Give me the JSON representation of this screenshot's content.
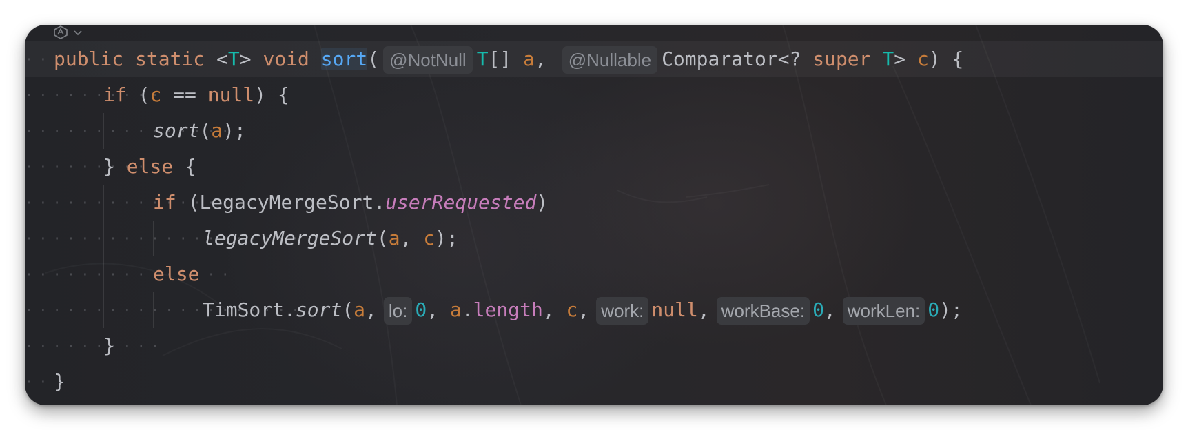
{
  "toolbar": {
    "icon": "ai-assistant-icon",
    "dropdown_icon": "chevron-down-icon"
  },
  "code": {
    "line1": {
      "kw_public": "public",
      "kw_static": "static",
      "lt": "<",
      "type_T": "T",
      "gt": ">",
      "kw_void": "void",
      "method_name": "sort",
      "open_paren": "(",
      "ann_notnull": "@NotNull",
      "param_type": "T",
      "brackets": "[]",
      "param_a": "a",
      "comma": ",",
      "ann_nullable": "@Nullable",
      "comparator": "Comparator<?",
      "kw_super": "super",
      "type_T2": "T",
      "gt2": ">",
      "param_c": "c",
      "close": ") {"
    },
    "line2": {
      "kw_if": "if",
      "open": "(",
      "var_c": "c",
      "op": "==",
      "kw_null": "null",
      "close": ") {"
    },
    "line3": {
      "call": "sort",
      "open": "(",
      "arg_a": "a",
      "close": ");"
    },
    "line4": {
      "brace": "}",
      "kw_else": "else",
      "open_brace": "{"
    },
    "line5": {
      "kw_if": "if",
      "open": "(",
      "cls": "LegacyMergeSort",
      "dot": ".",
      "field": "userRequested",
      "close": ")"
    },
    "line6": {
      "call": "legacyMergeSort",
      "open": "(",
      "arg_a": "a",
      "comma": ",",
      "arg_c": "c",
      "close": ");"
    },
    "line7": {
      "kw_else": "else"
    },
    "line8": {
      "cls": "TimSort",
      "dot": ".",
      "call": "sort",
      "open": "(",
      "arg_a": "a",
      "comma": ",",
      "hint_lo": "lo:",
      "num_0": "0",
      "arg_a2": "a",
      "dot2": ".",
      "field_length": "length",
      "arg_c": "c",
      "hint_work": "work:",
      "kw_null": "null",
      "hint_workbase": "workBase:",
      "num_0b": "0",
      "hint_worklen": "workLen:",
      "num_0c": "0",
      "close": ");"
    },
    "line9": {
      "brace": "}"
    },
    "line10": {
      "brace": "}"
    }
  },
  "colors": {
    "keyword": "#cf8e6d",
    "type_param": "#16baac",
    "parameter": "#c77c3a",
    "method_decl": "#56a8f5",
    "field": "#c77dbb",
    "number": "#2aacb8",
    "default_text": "#bcbec4",
    "hint_bg": "#3a3b3f"
  }
}
